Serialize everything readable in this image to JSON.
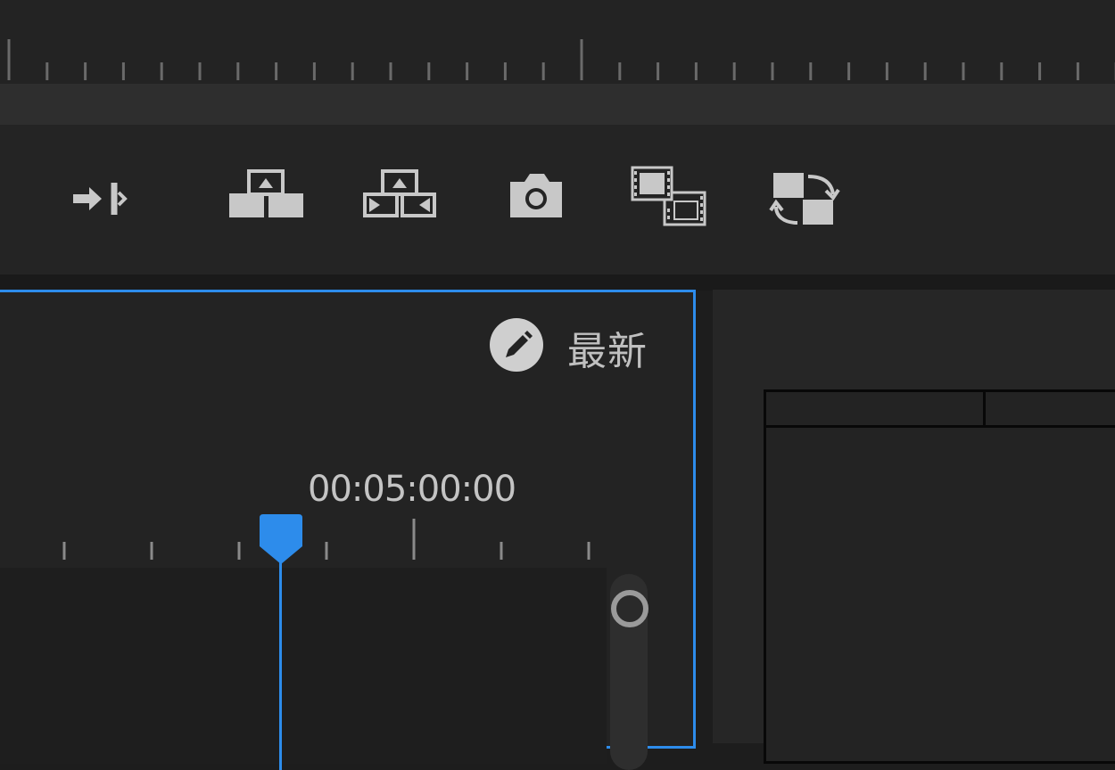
{
  "toolbar": {
    "buttons": [
      {
        "name": "insert-edit-icon"
      },
      {
        "name": "lift-icon"
      },
      {
        "name": "extract-icon"
      },
      {
        "name": "export-frame-icon"
      },
      {
        "name": "insert-clip-icon"
      },
      {
        "name": "replace-clip-icon"
      }
    ]
  },
  "timeline": {
    "latest_label": "最新",
    "timecode": "00:05:00:00"
  },
  "colors": {
    "accent": "#2d8ceb",
    "icon": "#c8c8c8",
    "background": "#232323"
  }
}
